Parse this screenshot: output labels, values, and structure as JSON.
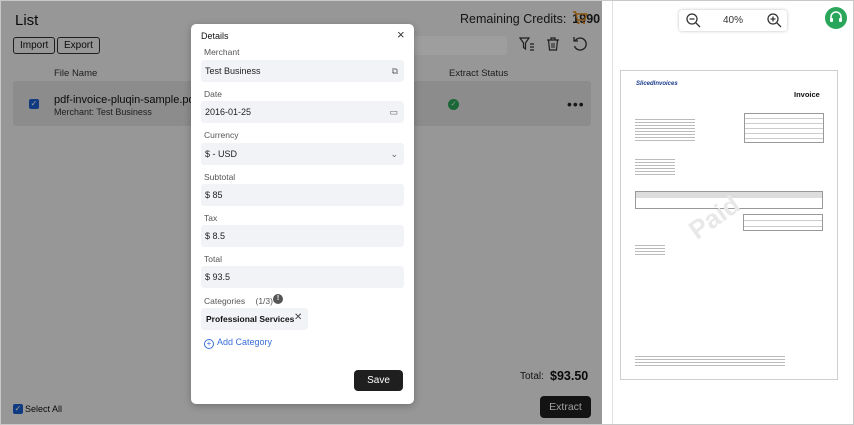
{
  "list": {
    "title": "List",
    "credits_label": "Remaining Credits:",
    "credits_value": "1990",
    "import_label": "Import",
    "export_label": "Export",
    "columns": {
      "file_name": "File Name",
      "extract_status": "Extract Status"
    },
    "rows": [
      {
        "file_name": "pdf-invoice-pluqin-sample.pdf",
        "merchant": "Merchant:  Test Business",
        "checked": true,
        "status": "success"
      }
    ],
    "total_label": "Total:",
    "total_value": "$93.50",
    "select_all_label": "Select All",
    "extract_label": "Extract"
  },
  "details": {
    "title": "Details",
    "close_icon": "close-icon",
    "fields": {
      "merchant_label": "Merchant",
      "merchant_value": "Test Business",
      "date_label": "Date",
      "date_value": "2016-01-25",
      "currency_label": "Currency",
      "currency_value": "$ - USD",
      "subtotal_label": "Subtotal",
      "subtotal_value": "$ 85",
      "tax_label": "Tax",
      "tax_value": "$ 8.5",
      "total_label": "Total",
      "total_value": "$ 93.5"
    },
    "categories_label": "Categories",
    "categories_count": "(1/3)",
    "categories": [
      "Professional Services"
    ],
    "add_category_label": "Add Category",
    "save_label": "Save"
  },
  "preview": {
    "zoom": "40%",
    "document": {
      "logo": "SlicedInvoices",
      "title": "Invoice",
      "watermark": "Paid"
    }
  },
  "colors": {
    "accent_orange": "#e08a1a",
    "success_green": "#2aa65a",
    "link_blue": "#3a6fd8",
    "checkbox_blue": "#1a5fd1",
    "button_dark": "#1f1f1f"
  }
}
